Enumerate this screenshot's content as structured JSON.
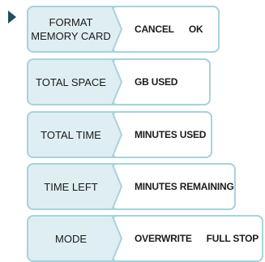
{
  "rows": [
    {
      "label": "FORMAT\nMEMORY CARD",
      "values": [
        "CANCEL",
        "OK"
      ]
    },
    {
      "label": "TOTAL SPACE",
      "values": [
        "GB USED"
      ]
    },
    {
      "label": "TOTAL TIME",
      "values": [
        "MINUTES USED"
      ]
    },
    {
      "label": "TIME LEFT",
      "values": [
        "MINUTES REMAINING"
      ]
    },
    {
      "label": "MODE",
      "values": [
        "OVERWRITE",
        "FULL STOP"
      ]
    }
  ],
  "colors": {
    "panel_fill": "#dfeef2",
    "panel_border": "#a8d2dc",
    "pointer": "#1f4f5e"
  },
  "icons": {
    "pointer": "selection-arrow-icon"
  }
}
